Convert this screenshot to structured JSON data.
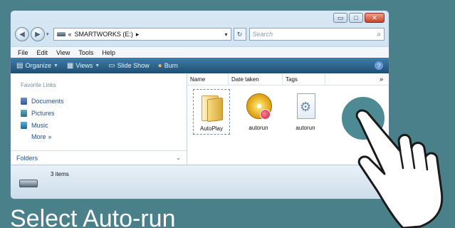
{
  "window": {
    "controls": {
      "minimize": "▭",
      "maximize": "□",
      "close": "✕"
    }
  },
  "address": {
    "path_prefix": "«",
    "path": "SMARTWORKS (E:)",
    "path_arrow": "▸",
    "search_placeholder": "Search"
  },
  "menu": [
    "File",
    "Edit",
    "View",
    "Tools",
    "Help"
  ],
  "toolbar": {
    "organize": "Organize",
    "views": "Views",
    "slideshow": "Slide Show",
    "burn": "Burn"
  },
  "navpane": {
    "title": "Favorite Links",
    "links": [
      "Documents",
      "Pictures",
      "Music"
    ],
    "more": "More",
    "folders": "Folders"
  },
  "columns": {
    "name": "Name",
    "date": "Date taken",
    "tags": "Tags",
    "more": "»"
  },
  "files": [
    {
      "label": "AutoPlay",
      "icon": "folder-icon"
    },
    {
      "label": "autorun",
      "icon": "cd-autorun-icon"
    },
    {
      "label": "autorun",
      "icon": "settings-file-icon"
    }
  ],
  "status": {
    "items": "3 items"
  },
  "caption": "Select Auto-run"
}
